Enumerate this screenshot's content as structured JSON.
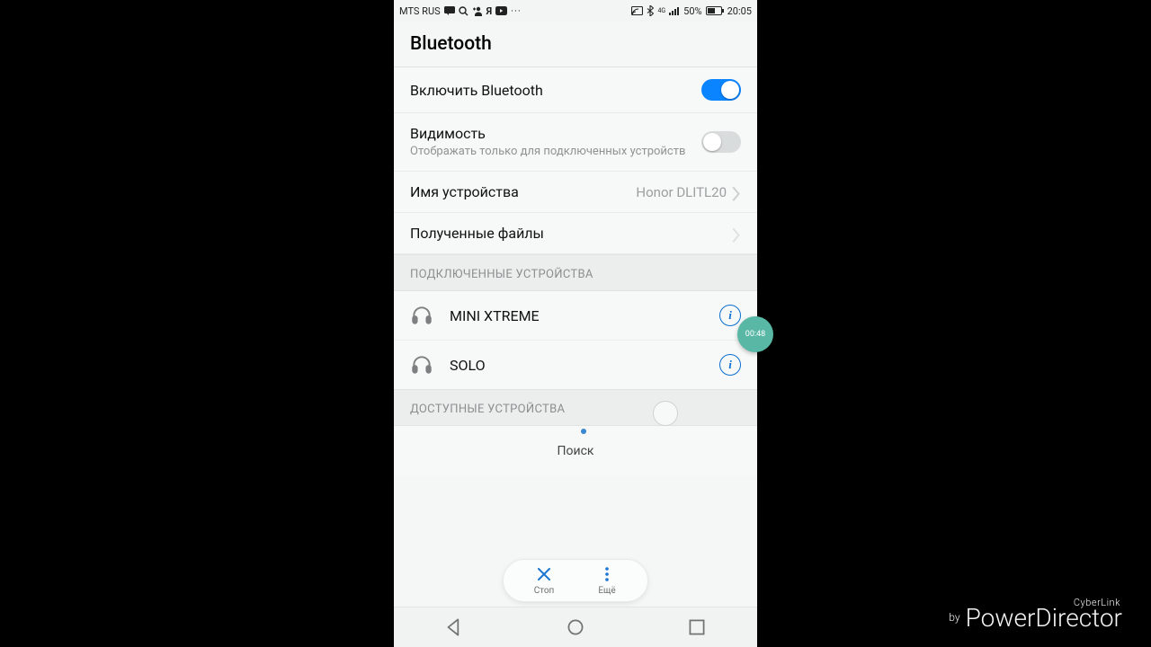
{
  "status": {
    "carrier": "MTS RUS",
    "signal": "50%",
    "time": "20:05"
  },
  "header": {
    "title": "Bluetooth"
  },
  "rows": {
    "enable": {
      "label": "Включить Bluetooth",
      "on": true
    },
    "visibility": {
      "label": "Видимость",
      "sub": "Отображать только для подключенных устройств",
      "on": false
    },
    "name": {
      "label": "Имя устройства",
      "value": "Honor DLITL20"
    },
    "files": {
      "label": "Полученные файлы"
    }
  },
  "sections": {
    "paired": "ПОДКЛЮЧЕННЫЕ УСТРОЙСТВА",
    "available": "ДОСТУПНЫЕ УСТРОЙСТВА"
  },
  "devices": {
    "paired": [
      {
        "name": "MINI XTREME"
      },
      {
        "name": "SOLO"
      }
    ]
  },
  "searching": "Поиск",
  "pill": {
    "stop": "Стоп",
    "more": "Ещё"
  },
  "bubble": "00:48",
  "watermark": {
    "brand": "CyberLink",
    "by": "by",
    "product": "PowerDirector"
  }
}
